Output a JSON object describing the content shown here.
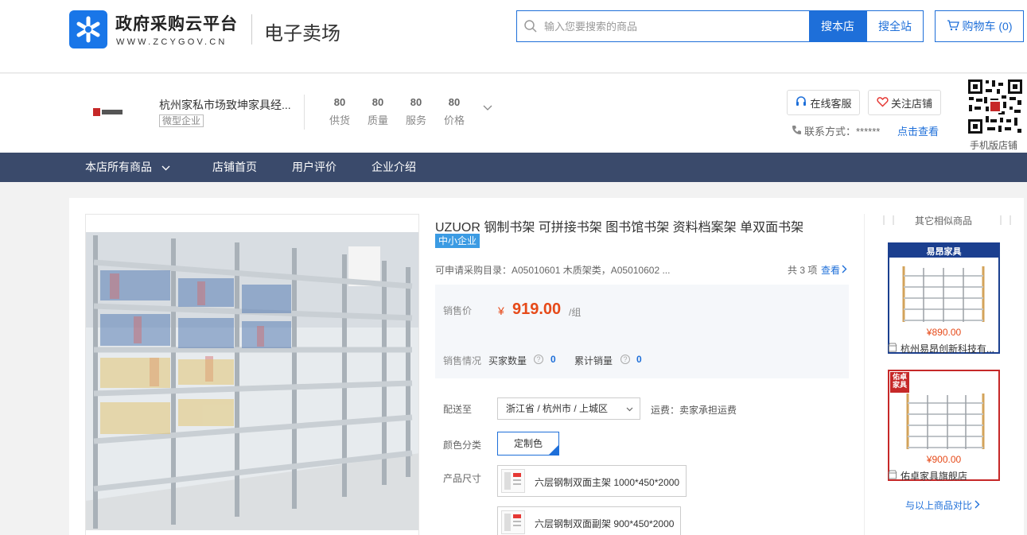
{
  "header": {
    "logo_title": "政府采购云平台",
    "logo_url": "WWW.ZCYGOV.CN",
    "logo_sub": "电子卖场",
    "search_placeholder": "输入您要搜索的商品",
    "btn_search_store": "搜本店",
    "btn_search_all": "搜全站",
    "cart_label": "购物车 (0)"
  },
  "store": {
    "name": "杭州家私市场致坤家具经...",
    "tag": "微型企业",
    "scores": [
      {
        "value": "80",
        "label": "供货"
      },
      {
        "value": "80",
        "label": "质量"
      },
      {
        "value": "80",
        "label": "服务"
      },
      {
        "value": "80",
        "label": "价格"
      }
    ],
    "btn_service": "在线客服",
    "btn_follow": "关注店铺",
    "contact": "联系方式：******",
    "contact_link": "点击查看",
    "qr_label": "手机版店铺"
  },
  "nav": {
    "items": [
      "本店所有商品",
      "店铺首页",
      "用户评价",
      "企业介绍"
    ]
  },
  "product": {
    "title": "UZUOR 钢制书架 可拼接书架 图书馆书架 资料档案架 单双面书架",
    "badge": "中小企业",
    "catalog": "可申请采购目录：A05010601 木质架类，A05010602 ...",
    "catalog_count": "共 3 项",
    "catalog_link": "查看",
    "price_label": "销售价",
    "price_symbol": "¥",
    "price_value": "919.00",
    "price_unit": "/组",
    "sales_label": "销售情况",
    "buyers_label": "买家数量",
    "buyers_value": "0",
    "total_label": "累计销量",
    "total_value": "0",
    "ship_label": "配送至",
    "region": "浙江省 / 杭州市 / 上城区",
    "shipping": "运费：卖家承担运费",
    "color_label": "颜色分类",
    "color_value": "定制色",
    "size_label": "产品尺寸",
    "sizes": [
      "六层钢制双面主架 1000*450*2000",
      "六层钢制双面副架 900*450*2000"
    ]
  },
  "sidebar": {
    "title": "其它相似商品",
    "items": [
      {
        "brand": "易昂家具",
        "price": "¥890.00",
        "name": "杭州易昂创新科技有..."
      },
      {
        "brand": "佑卓家具",
        "price": "¥900.00",
        "name": "佑卓家具旗舰店"
      }
    ],
    "compare": "与以上商品对比"
  },
  "colors": {
    "primary": "#1e6fd9",
    "nav_bg": "#3a4a6b",
    "price": "#e64a19",
    "badge": "#3b9be3"
  }
}
